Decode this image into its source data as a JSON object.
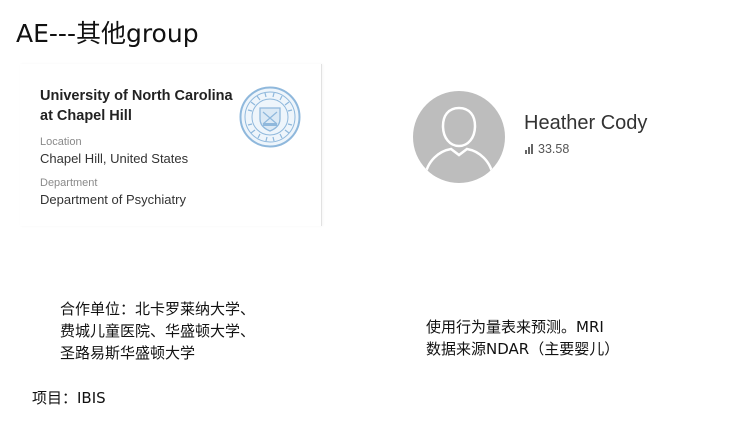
{
  "slide": {
    "title": "AE---其他group"
  },
  "university_card": {
    "name_line1": "University of North Carolina",
    "name_line2": "at Chapel Hill",
    "location_label": "Location",
    "location_value": "Chapel Hill, United States",
    "department_label": "Department",
    "department_value": "Department of Psychiatry",
    "seal_icon": "university-seal-icon",
    "seal_color": "#8fb8dc"
  },
  "profile": {
    "name": "Heather Cody",
    "score": "33.58",
    "score_icon": "signal-bars-icon",
    "avatar_icon": "default-avatar-icon",
    "avatar_bg": "#bdbdbd"
  },
  "notes": {
    "partners_lines": [
      "合作单位：北卡罗莱纳大学、",
      "费城儿童医院、华盛顿大学、",
      "圣路易斯华盛顿大学"
    ],
    "method_lines": [
      "使用行为量表来预测。MRI",
      "数据来源NDAR（主要婴儿）"
    ],
    "project": "项目：IBIS"
  }
}
